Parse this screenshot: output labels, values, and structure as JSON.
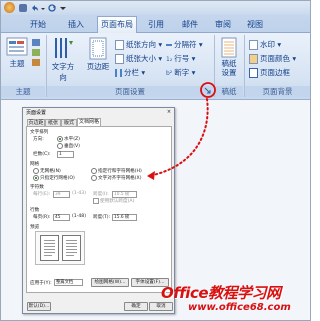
{
  "tabs": [
    {
      "label": "开始"
    },
    {
      "label": "插入"
    },
    {
      "label": "页面布局"
    },
    {
      "label": "引用"
    },
    {
      "label": "邮件"
    },
    {
      "label": "审阅"
    },
    {
      "label": "视图"
    }
  ],
  "ribbon": {
    "theme_group": {
      "label": "主题",
      "button": "主题"
    },
    "page_setup": {
      "label": "页面设置",
      "text_direction": "文字方向",
      "margins": "页边距",
      "orientation": "纸张方向",
      "size": "纸张大小",
      "columns": "分栏",
      "breaks": "分隔符",
      "line_numbers": "行号",
      "hyphenation": "断字"
    },
    "manuscript": {
      "label": "稿纸",
      "button": "稿纸\n设置"
    },
    "background": {
      "label": "页面背景",
      "watermark": "水印",
      "page_color": "页面颜色",
      "page_borders": "页面边框"
    }
  },
  "dialog": {
    "title": "页面设置",
    "tabs": [
      "页边距",
      "纸张",
      "版式",
      "文档网格"
    ],
    "text_direction_section": "文字排列",
    "direction_label": "方向:",
    "dir_horizontal": "水平(Z)",
    "dir_vertical": "垂直(V)",
    "columns_label": "栏数(C):",
    "columns_value": "1",
    "grid_section": "网格",
    "grid_none": "无网格(N)",
    "grid_lines_only": "只指定行网格(O)",
    "grid_lines_chars": "指定行和字符网格(H)",
    "grid_text_snap": "文字对齐字符网格(X)",
    "chars_section": "字符数",
    "per_line_label": "每行(E):",
    "per_line_value": "39",
    "per_line_range": "(1-43)",
    "pitch_label": "跨度(I):",
    "pitch_value": "10.5 磅",
    "use_default": "使用默认跨度(A)",
    "lines_section": "行数",
    "per_page_label": "每页(R):",
    "per_page_value": "45",
    "per_page_range": "(1-48)",
    "line_pitch_label": "跨度(T):",
    "line_pitch_value": "15.6 磅",
    "preview_section": "预览",
    "apply_label": "应用于(Y):",
    "apply_value": "整篇文档",
    "draw_grid": "绘图网格(W)...",
    "font_settings": "字体设置(F)...",
    "default_btn": "默认(D)...",
    "ok_btn": "确定",
    "cancel_btn": "取消"
  },
  "watermark": {
    "line1": "Office教程学习网",
    "line2": "www.office68.com"
  },
  "colors": {
    "accent_red": "#d81010",
    "ribbon_blue": "#15428b"
  }
}
